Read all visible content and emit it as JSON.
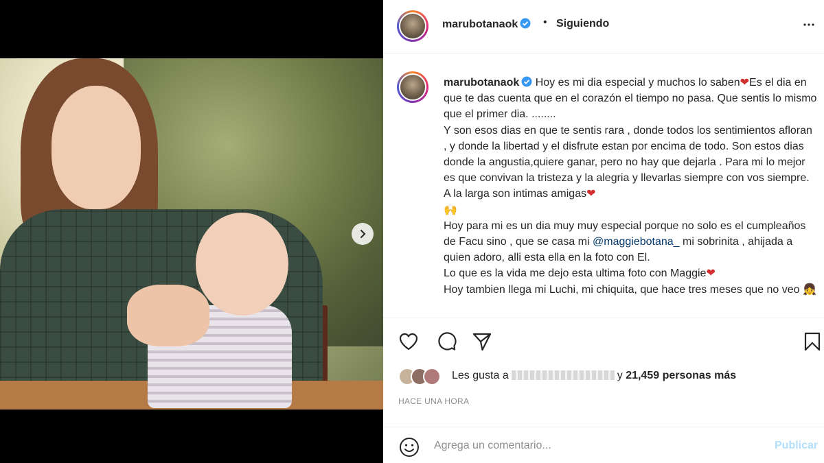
{
  "header": {
    "username": "marubotanaok",
    "separator": "•",
    "follow_label": "Siguiendo"
  },
  "caption": {
    "username": "marubotanaok",
    "lines": [
      "Hoy es mi dia especial y muchos lo saben",
      "Es el dia en que te das cuenta que en el corazón el tiempo no pasa. Que sentis lo mismo que el primer dia. ........",
      "Y son esos dias en que te sentis rara , donde todos los sentimientos afloran , y donde la libertad y el disfrute estan por encima de todo. Son estos dias donde la angustia,quiere ganar, pero no hay que dejarla . Para mi lo mejor es que convivan la tristeza y la alegria y llevarlas siempre con vos siempre. A la larga son intimas amigas",
      "Hoy para mi es un dia muy muy especial porque no solo es el cumpleaños de Facu sino , que se casa mi",
      "@maggiebotana_",
      "mi sobrinita , ahijada a quien adoro, alli esta ella en la foto con El.",
      "Lo que es la vida me dejo esta ultima foto con Maggie",
      "Hoy tambien llega mi Luchi, mi chiquita, que hace tres meses que no veo"
    ],
    "heart": "❤",
    "hands_emoji": "🙌",
    "girl_emoji": "👧"
  },
  "likes": {
    "prefix": "Les gusta a",
    "suffix": "y",
    "count": "21,459 personas más"
  },
  "time": "HACE UNA HORA",
  "comment": {
    "placeholder": "Agrega un comentario...",
    "publish_label": "Publicar"
  },
  "colors": {
    "verified": "#3897f0",
    "publish_disabled": "#b2dffc",
    "mention": "#00376b",
    "heart": "#d32f2f"
  },
  "icons": [
    "chevron-right-icon",
    "verified-icon",
    "more-icon",
    "heart-icon",
    "comment-icon",
    "share-icon",
    "bookmark-icon",
    "emoji-icon"
  ]
}
